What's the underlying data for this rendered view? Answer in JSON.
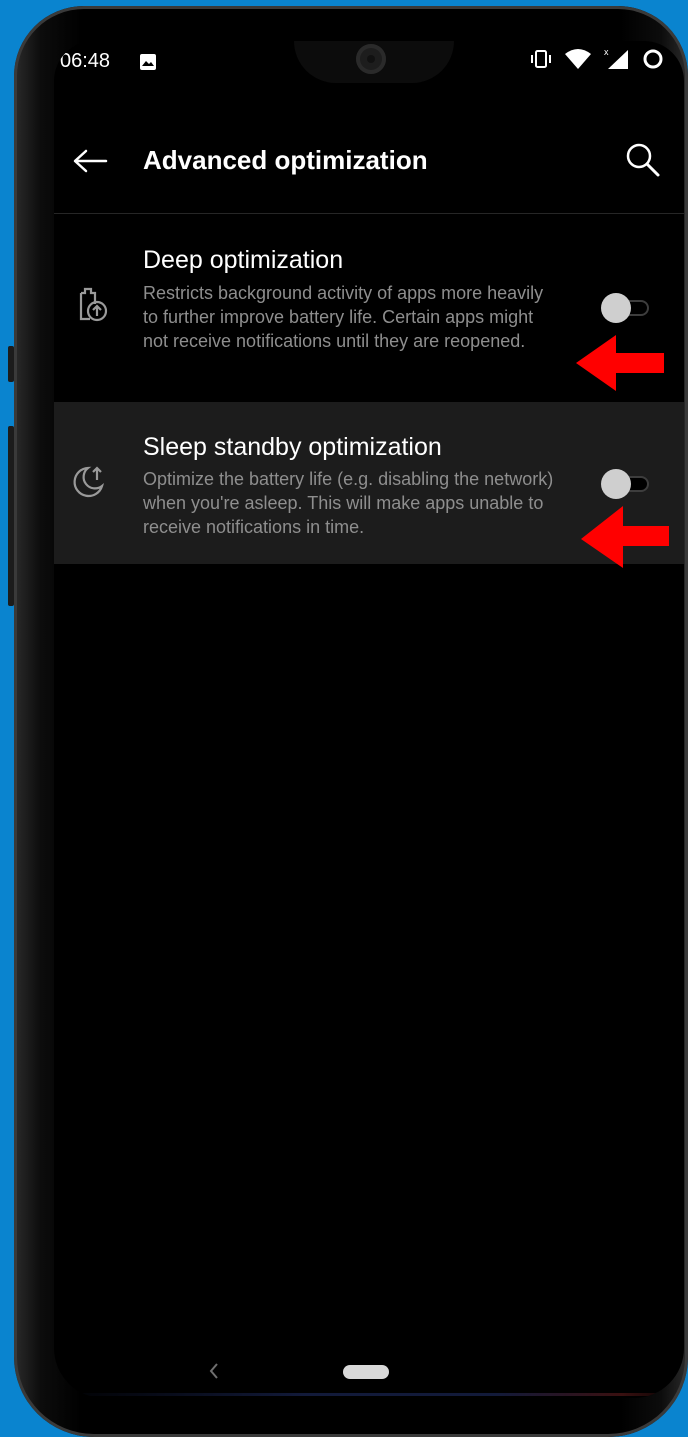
{
  "status_bar": {
    "time": "06:48",
    "left_icons": [
      "image-icon"
    ],
    "right_icons": [
      "vibrate-icon",
      "wifi-icon",
      "signal-icon",
      "battery-saver-ring-icon"
    ]
  },
  "app_bar": {
    "back_icon": "arrow-left-icon",
    "title": "Advanced optimization",
    "search_icon": "search-icon"
  },
  "settings": [
    {
      "icon": "battery-upload-icon",
      "title": "Deep optimization",
      "description": "Restricts background activity of apps more heavily to further improve battery life. Certain apps might not receive notifications until they are reopened.",
      "enabled": false,
      "highlighted": false
    },
    {
      "icon": "moon-up-arrow-icon",
      "title": "Sleep standby optimization",
      "description": "Optimize the battery life (e.g. disabling the network) when you're asleep. This will make apps unable to receive notifications in time.",
      "enabled": false,
      "highlighted": true
    }
  ],
  "annotations": {
    "arrow_color": "#ff0000",
    "count": 2
  },
  "colors": {
    "background": "#000000",
    "row_highlight": "#1c1c1c",
    "frame": "#0a84cf"
  },
  "nav_bar": {
    "back_icon": "chevron-left-icon",
    "home_icon": "home-pill-icon"
  }
}
